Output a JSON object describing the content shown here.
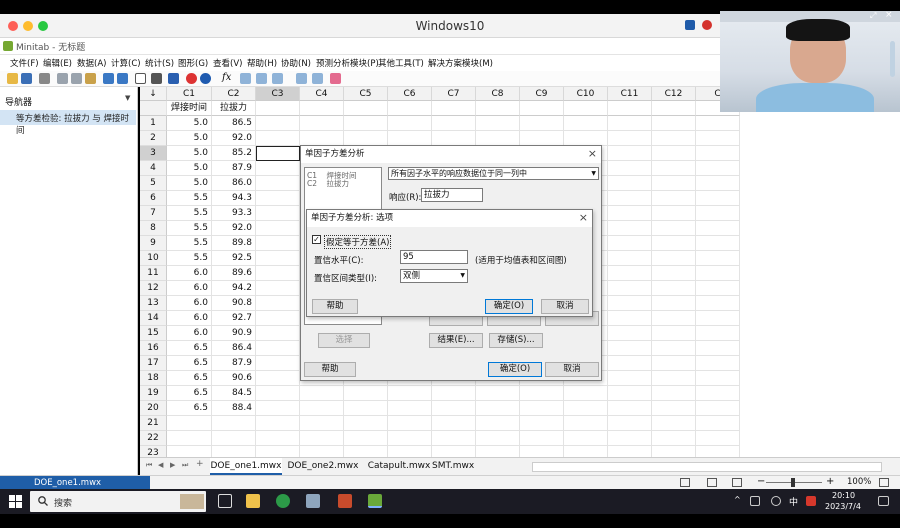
{
  "window": {
    "title": "Windows10"
  },
  "app": {
    "title": "Minitab - 无标题"
  },
  "menu": [
    "文件(F)",
    "编辑(E)",
    "数据(A)",
    "计算(C)",
    "统计(S)",
    "图形(G)",
    "查看(V)",
    "帮助(H)",
    "协助(N)",
    "预测分析模块(P)",
    "其他工具(T)",
    "解决方案模块(M)"
  ],
  "toolbar": {
    "fx_label": "fx"
  },
  "navigator": {
    "header": "导航器",
    "item": "等方差检验: 拉拔力 与 焊接时间"
  },
  "sheet": {
    "corner": "↓",
    "columns": [
      "C1",
      "C2",
      "C3",
      "C4",
      "C5",
      "C6",
      "C7",
      "C8",
      "C9",
      "C10",
      "C11",
      "C12",
      "C"
    ],
    "column_names": [
      "焊接时间",
      "拉拔力"
    ],
    "row_numbers": [
      "1",
      "2",
      "3",
      "4",
      "5",
      "6",
      "7",
      "8",
      "9",
      "10",
      "11",
      "12",
      "13",
      "14",
      "15",
      "16",
      "17",
      "18",
      "19",
      "20",
      "21",
      "22",
      "23"
    ],
    "rows": [
      [
        "5.0",
        "86.5"
      ],
      [
        "5.0",
        "92.0"
      ],
      [
        "5.0",
        "85.2"
      ],
      [
        "5.0",
        "87.9"
      ],
      [
        "5.0",
        "86.0"
      ],
      [
        "5.5",
        "94.3"
      ],
      [
        "5.5",
        "93.3"
      ],
      [
        "5.5",
        "92.0"
      ],
      [
        "5.5",
        "89.8"
      ],
      [
        "5.5",
        "92.5"
      ],
      [
        "6.0",
        "89.6"
      ],
      [
        "6.0",
        "94.2"
      ],
      [
        "6.0",
        "90.8"
      ],
      [
        "6.0",
        "92.7"
      ],
      [
        "6.0",
        "90.9"
      ],
      [
        "6.5",
        "86.4"
      ],
      [
        "6.5",
        "87.9"
      ],
      [
        "6.5",
        "90.6"
      ],
      [
        "6.5",
        "84.5"
      ],
      [
        "6.5",
        "88.4"
      ]
    ]
  },
  "sheet_tabs": [
    "DOE_one1.mwx",
    "DOE_one2.mwx",
    "Catapult.mwx",
    "SMT.mwx"
  ],
  "tab_nav": [
    "⏮",
    "◀",
    "▶",
    "⏭",
    "+"
  ],
  "status": {
    "file": "DOE_one1.mwx",
    "zoom": "100%"
  },
  "taskbar": {
    "search_placeholder": "搜索",
    "time": "20:10",
    "date": "2023/7/4",
    "ime": "中"
  },
  "dialog_main": {
    "title": "单因子方差分析",
    "list": [
      "C1    焊接时间",
      "C2    拉拔力"
    ],
    "dropdown": "所有因子水平的响应数据位于同一列中",
    "response_label": "响应(R):",
    "response_value": "拉拔力",
    "select_btn": "选择",
    "help_btn": "帮助",
    "results_btn": "结果(E)...",
    "storage_btn": "存储(S)...",
    "ok_btn": "确定(O)",
    "cancel_btn": "取消"
  },
  "dialog_options": {
    "title": "单因子方差分析: 选项",
    "equal_var_label": "假定等于方差(A)",
    "equal_var_checked": true,
    "conf_level_label": "置信水平(C):",
    "conf_level_value": "95",
    "conf_level_note": "(适用于均值表和区间图)",
    "interval_type_label": "置信区间类型(I):",
    "interval_type_value": "双侧",
    "help_btn": "帮助",
    "ok_btn": "确定(O)",
    "cancel_btn": "取消"
  }
}
